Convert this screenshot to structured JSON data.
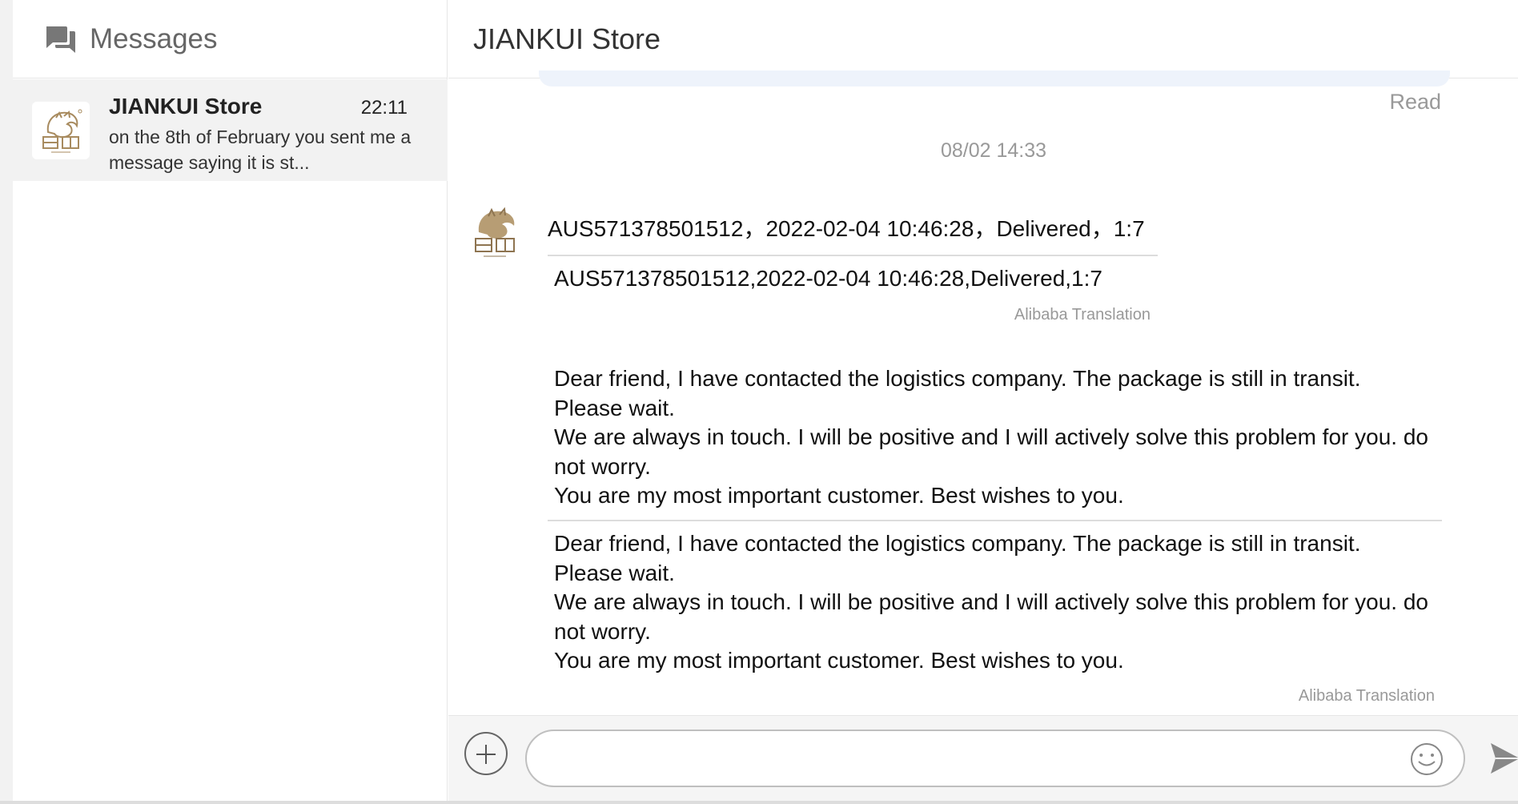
{
  "sidebar": {
    "title": "Messages",
    "icon": "chat-bubbles-icon",
    "conversations": [
      {
        "name": "JIANKUI Store",
        "time": "22:11",
        "preview": "on the 8th of February you sent me a message saying it is st..."
      }
    ]
  },
  "chat": {
    "title": "JIANKUI Store",
    "read_status": "Read",
    "timestamp": "08/02 14:33",
    "messages": [
      {
        "original": "AUS571378501512，2022-02-04 10:46:28，Delivered，1:7",
        "translation": "AUS571378501512,2022-02-04 10:46:28,Delivered,1:7",
        "translation_label": "Alibaba Translation"
      },
      {
        "original": "Dear friend, I have contacted the logistics company. The package is still in transit.\nPlease wait.\nWe are always in touch. I will be positive and I will actively solve this problem for you. do not worry.\nYou are my most important customer. Best wishes to you.",
        "translation": "Dear friend, I have contacted the logistics company. The package is still in transit.\nPlease wait.\nWe are always in touch. I will be positive and I will actively solve this problem for you. do not worry.\nYou are my most important customer. Best wishes to you.",
        "translation_label": "Alibaba Translation"
      }
    ]
  },
  "input": {
    "placeholder": "",
    "icons": [
      "plus-icon",
      "emoji-icon",
      "send-icon"
    ]
  },
  "colors": {
    "sidebar_active": "#f2f2f2",
    "muted_text": "#999999",
    "bubble_tint": "#eef3fb"
  }
}
